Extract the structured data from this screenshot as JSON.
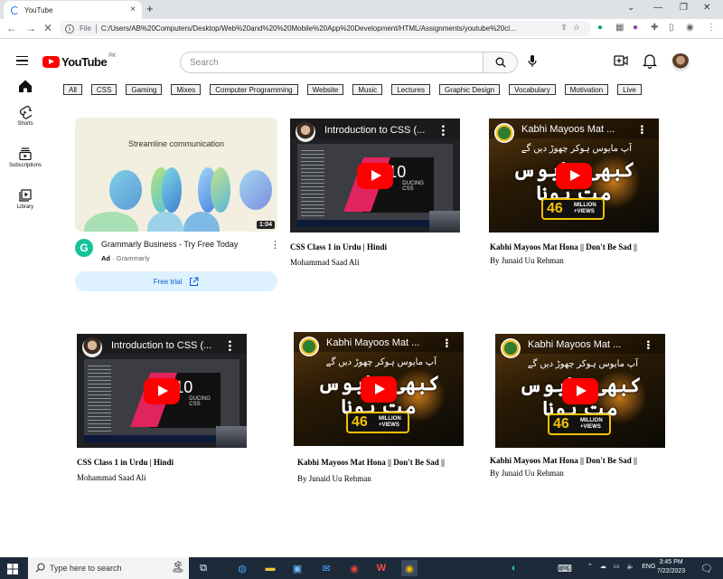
{
  "browser": {
    "tab_title": "YouTube",
    "tab_close": "×",
    "new_tab": "+",
    "file_label": "File",
    "url": "C:/Users/AB%20Computers/Desktop/Web%20and%20%20Mobile%20App%20Development/HTML/Assignments/youtube%20cl..."
  },
  "header": {
    "logo_text": "YouTube",
    "country_code": "PK",
    "search_placeholder": "Search"
  },
  "sidebar": {
    "items": [
      {
        "label": "",
        "icon": "home-icon"
      },
      {
        "label": "Shorts",
        "icon": "shorts-icon"
      },
      {
        "label": "Subscriptions",
        "icon": "subscriptions-icon"
      },
      {
        "label": "Library",
        "icon": "library-icon"
      }
    ]
  },
  "chips": [
    "All",
    "CSS",
    "Gaming",
    "Mixes",
    "Computer Programming",
    "Website",
    "Music",
    "Lectures",
    "Graphic Design",
    "Vocabulary",
    "Motivation",
    "Live"
  ],
  "ad": {
    "headline": "Streamline communication",
    "duration": "1:04",
    "logo_letter": "G",
    "title": "Grammarly Business - Try Free Today",
    "ad_label": "Ad",
    "dot": "·",
    "channel": "Grammarly",
    "button": "Free trial"
  },
  "thumbs": {
    "css_title": "Introduction to CSS (...",
    "css_number": "10",
    "css_sub": "DUCING CSS",
    "urdu_title": "Kabhi Mayoos Mat ...",
    "urdu_title_full": "Kabhi Mayoos Mat ...",
    "urdu_line": "آپ مایوس ہوکر چھوڑ دیں گے",
    "urdu_big": "کبھی مایوس مت ہونا",
    "badge_number": "46",
    "badge_text1": "MILLION",
    "badge_text2": "+VIEWS"
  },
  "videos": [
    {
      "title": "CSS Class 1 in Urdu | Hindi",
      "channel": "Mohammad Saad Ali"
    },
    {
      "title": "Kabhi Mayoos Mat Hona || Don't Be Sad ||",
      "channel": "By Junaid Uu Rehman"
    },
    {
      "title": "CSS Class 1 in Urdu | Hindi",
      "channel": "Mohammad Saad Ali"
    },
    {
      "title": "Kabhi Mayoos Mat Hona || Don't Be Sad ||",
      "channel": "By Junaid Uu Rehman"
    },
    {
      "title": "Kabhi Mayoos Mat Hona || Don't Be Sad ||",
      "channel": "By Junaid Uu Rehman"
    }
  ],
  "taskbar": {
    "search_placeholder": "Type here to search",
    "lang": "ENG",
    "time": "3:45 PM",
    "date": "7/22/2023"
  }
}
